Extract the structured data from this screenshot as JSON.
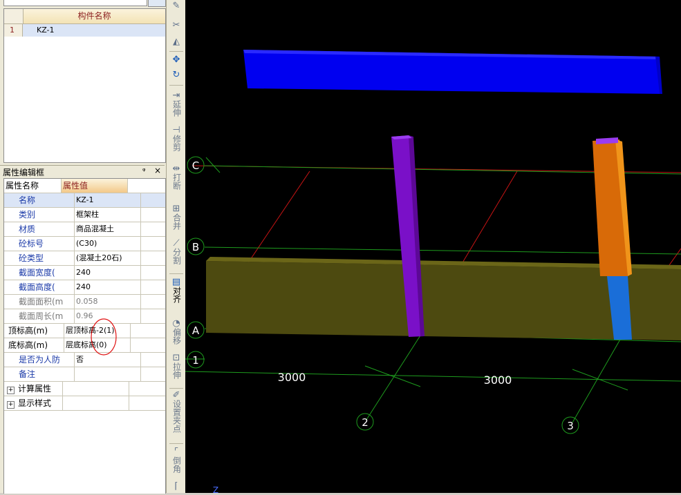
{
  "component_list": {
    "header": "构件名称",
    "rows": [
      {
        "num": "1",
        "name": "KZ-1"
      }
    ]
  },
  "property_panel": {
    "title": "属性编辑框",
    "pin_glyph": "ᵠ",
    "close_glyph": "×",
    "col_name": "属性名称",
    "col_value": "属性值",
    "rows": [
      {
        "key": "名称",
        "value": "KZ-1"
      },
      {
        "key": "类别",
        "value": "框架柱"
      },
      {
        "key": "材质",
        "value": "商品混凝土"
      },
      {
        "key": "砼标号",
        "value": "(C30)"
      },
      {
        "key": "砼类型",
        "value": "(混凝土20石)"
      },
      {
        "key": "截面宽度(",
        "value": "240"
      },
      {
        "key": "截面高度(",
        "value": "240"
      },
      {
        "key": "截面面积(m",
        "value": "0.058"
      },
      {
        "key": "截面周长(m",
        "value": "0.96"
      },
      {
        "key": "顶标高(m)",
        "value": "层顶标高-2(1)"
      },
      {
        "key": "底标高(m)",
        "value": "层底标高(0)"
      },
      {
        "key": "是否为人防",
        "value": "否"
      },
      {
        "key": "备注",
        "value": ""
      },
      {
        "key": "计算属性",
        "value": ""
      },
      {
        "key": "显示样式",
        "value": ""
      }
    ]
  },
  "toolbar": {
    "extend": "延伸",
    "trim": "修剪",
    "break": "打断",
    "merge": "合并",
    "split": "分割",
    "align": "对齐",
    "offset": "偏移",
    "stretch": "拉伸",
    "set_point": "设置夹点",
    "chamfer": "倒角"
  },
  "viewport": {
    "axis_C": "C",
    "axis_B": "B",
    "axis_A": "A",
    "axis_1": "1",
    "axis_2": "2",
    "axis_3": "3",
    "dim_1": "3000",
    "dim_2": "3000",
    "z_label": "Z"
  },
  "colors": {
    "beam_blue": "#0000f0",
    "column_purple": "#7a10c8",
    "column_orange": "#d86a08",
    "column_blue": "#1a6ed8",
    "wall_olive": "#4d4a10",
    "grid_green": "#1e9c1e",
    "grid_red": "#c81414",
    "annotation_red": "#e01010"
  }
}
